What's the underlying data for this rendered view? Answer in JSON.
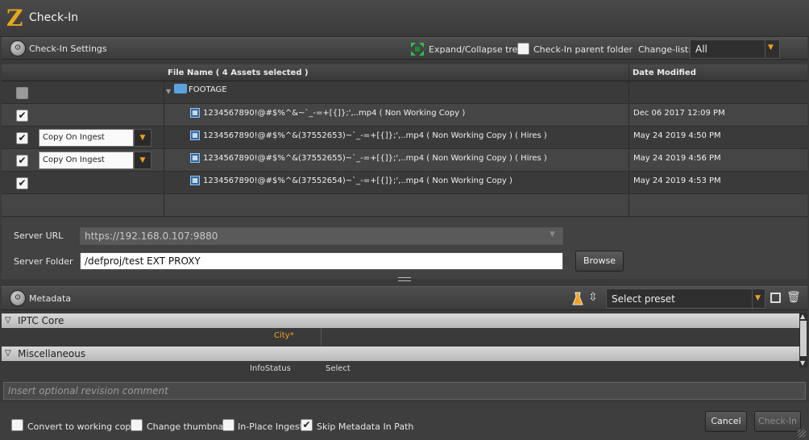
{
  "window": {
    "title": "Check-In",
    "logo_letter": "Z"
  },
  "checkin_settings": {
    "label": "Check-In Settings",
    "expand_collapse_label": "Expand/Collapse tree",
    "parent_folder_label": "Check-In parent folder",
    "changelist_label": "Change-list:",
    "changelist_value": "All"
  },
  "table": {
    "col_filename": "File Name  ( 4 Assets selected )",
    "col_date": "Date Modified",
    "folder_name": "FOOTAGE",
    "rows": [
      {
        "checked": true,
        "ingest": "",
        "name": "1234567890!@#$%^&~`_-=+[{]};',..mp4 ( Non Working Copy )",
        "date": "Dec 06 2017 12:09 PM"
      },
      {
        "checked": true,
        "ingest": "Copy On Ingest",
        "name": "1234567890!@#$%^&(37552653)~`_-=+[{]};',..mp4 ( Non Working Copy ) ( Hires )",
        "date": "May 24 2019 4:50 PM"
      },
      {
        "checked": true,
        "ingest": "Copy On Ingest",
        "name": "1234567890!@#$%^&(37552655)~`_-=+[{]};',..mp4 ( Non Working Copy ) ( Hires )",
        "date": "May 24 2019 4:56 PM"
      },
      {
        "checked": true,
        "ingest": "",
        "name": "1234567890!@#$%^&(37552654)~`_-=+[{]};',..mp4 ( Non Working Copy )",
        "date": "May 24 2019 4:53 PM"
      }
    ]
  },
  "server": {
    "url_label": "Server URL",
    "url_value": "https://192.168.0.107:9880",
    "folder_label": "Server Folder",
    "folder_value": "/defproj/test EXT PROXY",
    "browse_label": "Browse"
  },
  "metadata": {
    "label": "Metadata",
    "preset_placeholder": "Select preset",
    "group_iptc": "IPTC Core",
    "field_city": "City*",
    "group_misc": "Miscellaneous",
    "field_infostatus": "InfoStatus",
    "field_infostatus_value": "Select"
  },
  "revision": {
    "placeholder": "Insert optional revision comment"
  },
  "footer": {
    "convert_label": "Convert to working copy",
    "thumbnail_label": "Change thumbnail",
    "inplace_label": "In-Place Ingest",
    "skip_label": "Skip Metadata In Path",
    "cancel_label": "Cancel",
    "checkin_label": "Check-In"
  },
  "colors": {
    "accent": "#f0a020",
    "background": "#3a3a3a"
  }
}
